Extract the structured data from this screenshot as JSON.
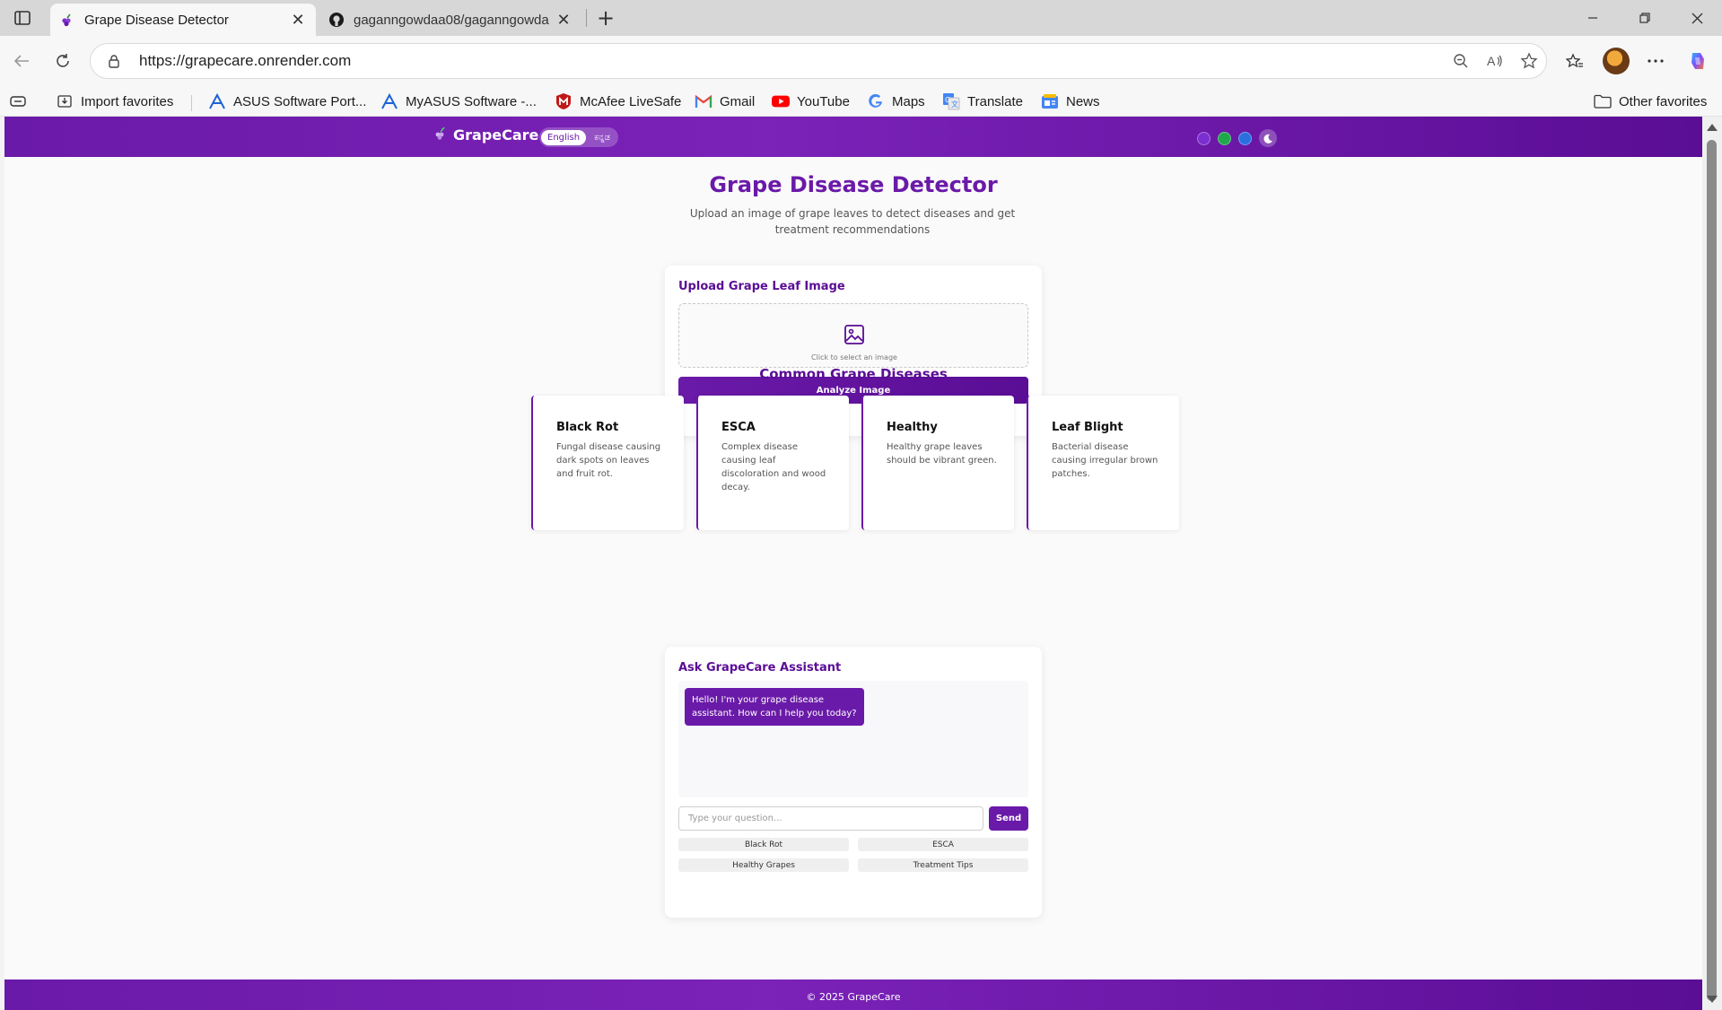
{
  "browser": {
    "tabs": [
      {
        "title": "Grape Disease Detector",
        "active": true
      },
      {
        "title": "gaganngowdaa08/gaganngowda",
        "active": false
      }
    ],
    "url": "https://grapecare.onrender.com",
    "favorites": [
      {
        "label": "Import favorites",
        "icon": "import-icon"
      },
      {
        "label": "ASUS Software Port...",
        "icon": "asus-icon"
      },
      {
        "label": "MyASUS Software -...",
        "icon": "asus-icon"
      },
      {
        "label": "McAfee LiveSafe",
        "icon": "mcafee-icon"
      },
      {
        "label": "Gmail",
        "icon": "gmail-icon"
      },
      {
        "label": "YouTube",
        "icon": "youtube-icon"
      },
      {
        "label": "Maps",
        "icon": "google-icon"
      },
      {
        "label": "Translate",
        "icon": "translate-icon"
      },
      {
        "label": "News",
        "icon": "news-icon"
      }
    ],
    "other_favorites": "Other favorites"
  },
  "site": {
    "brand": "GrapeCare",
    "languages": [
      "English",
      "ಕನ್ನಡ"
    ],
    "active_language": "English",
    "theme_colors": [
      "#7b2fd0",
      "#1fa84a",
      "#2a6fe0"
    ],
    "accent": "#6a1aa8"
  },
  "hero": {
    "title": "Grape Disease Detector",
    "subtitle": "Upload an image of grape leaves to detect diseases and get treatment recommendations"
  },
  "upload": {
    "title": "Upload Grape Leaf Image",
    "hint": "Click to select an image",
    "button": "Analyze Image"
  },
  "diseases": {
    "title": "Common Grape Diseases",
    "items": [
      {
        "name": "Black Rot",
        "desc": "Fungal disease causing dark spots on leaves and fruit rot."
      },
      {
        "name": "ESCA",
        "desc": "Complex disease causing leaf discoloration and wood decay."
      },
      {
        "name": "Healthy",
        "desc": "Healthy grape leaves should be vibrant green."
      },
      {
        "name": "Leaf Blight",
        "desc": "Bacterial disease causing irregular brown patches."
      }
    ]
  },
  "assistant": {
    "title": "Ask GrapeCare Assistant",
    "greeting": "Hello! I'm your grape disease assistant. How can I help you today?",
    "placeholder": "Type your question...",
    "send": "Send",
    "chips": [
      "Black Rot",
      "ESCA",
      "Healthy Grapes",
      "Treatment Tips"
    ]
  },
  "footer": {
    "copyright": "© 2025 GrapeCare"
  }
}
